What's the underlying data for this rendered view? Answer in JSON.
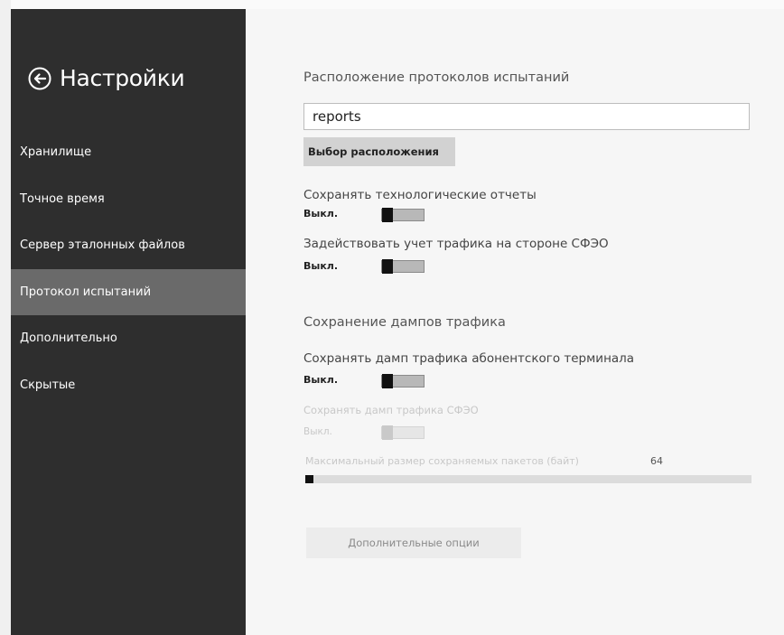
{
  "app": {
    "title": "Настройки"
  },
  "sidebar": {
    "items": [
      {
        "label": "Хранилище",
        "active": false
      },
      {
        "label": "Точное время",
        "active": false
      },
      {
        "label": "Сервер эталонных файлов",
        "active": false
      },
      {
        "label": "Протокол испытаний",
        "active": true
      },
      {
        "label": "Дополнительно",
        "active": false
      },
      {
        "label": "Скрытые",
        "active": false
      }
    ]
  },
  "main": {
    "location": {
      "title": "Расположение протоколов испытаний",
      "value": "reports",
      "choose_button": "Выбор расположения"
    },
    "save_tech_reports": {
      "label": "Сохранять технологические отчеты",
      "state": "Выкл."
    },
    "traffic_accounting": {
      "label": "Задействовать учет трафика на стороне СФЭО",
      "state": "Выкл."
    },
    "dumps": {
      "title": "Сохранение дампов трафика",
      "subscriber_dump": {
        "label": "Сохранять дамп трафика абонентского терминала",
        "state": "Выкл."
      },
      "sfeo_dump": {
        "label": "Сохранять дамп трафика СФЭО",
        "state": "Выкл."
      },
      "max_packet_size": {
        "label": "Максимальный размер сохраняемых пакетов (байт)",
        "value": "64"
      }
    },
    "more_options_button": "Дополнительные опции"
  },
  "colors": {
    "sidebar_bg": "#2e2e2e",
    "sidebar_active": "#6a6a6a",
    "content_bg": "#f6f6f6",
    "toggle_knob": "#111111",
    "toggle_track": "#b8b8b8"
  },
  "icons": {
    "back": "back-arrow-circle-icon"
  }
}
